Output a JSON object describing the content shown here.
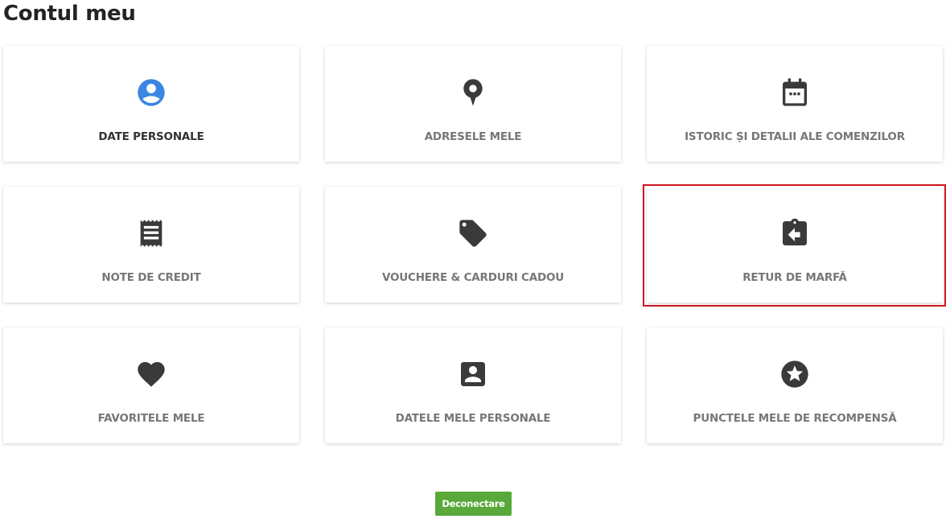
{
  "page": {
    "title": "Contul meu"
  },
  "colors": {
    "accent_blue": "#3b86e0",
    "icon_dark": "#3a3a3a",
    "label_gray": "#777777",
    "highlight_red": "#d0161e",
    "logout_green": "#59a83a"
  },
  "cards": [
    {
      "label": "DATE PERSONALE",
      "icon": "person-circle-icon"
    },
    {
      "label": "ADRESELE MELE",
      "icon": "map-pin-icon"
    },
    {
      "label": "ISTORIC ȘI DETALII ALE COMENZILOR",
      "icon": "calendar-icon"
    },
    {
      "label": "NOTE DE CREDIT",
      "icon": "receipt-icon"
    },
    {
      "label": "VOUCHERE & CARDURI CADOU",
      "icon": "tag-icon"
    },
    {
      "label": "RETUR DE MARFĂ",
      "icon": "clipboard-return-icon"
    },
    {
      "label": "FAVORITELE MELE",
      "icon": "heart-icon"
    },
    {
      "label": "DATELE MELE PERSONALE",
      "icon": "account-box-icon"
    },
    {
      "label": "PUNCTELE MELE DE RECOMPENSĂ",
      "icon": "star-circle-icon"
    }
  ],
  "logout": {
    "label": "Deconectare"
  }
}
